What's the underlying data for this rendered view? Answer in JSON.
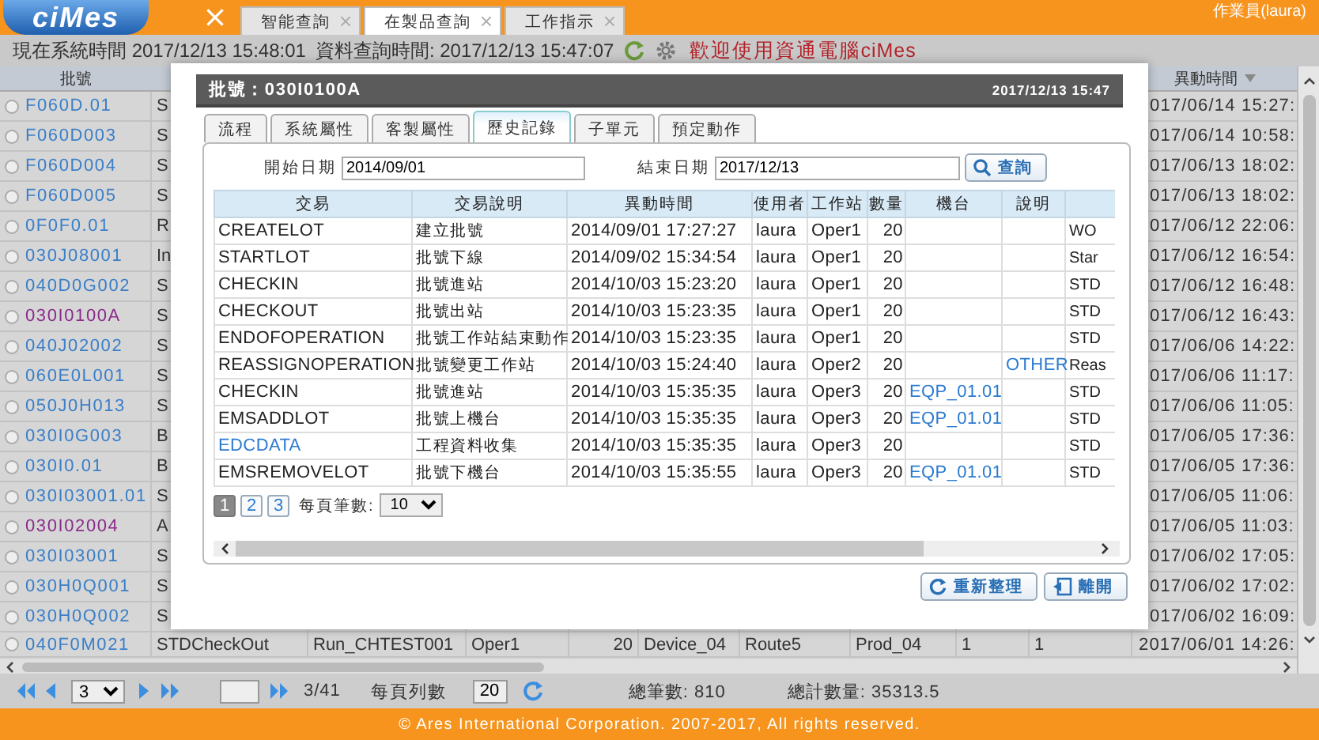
{
  "header": {
    "logo": "ciMes",
    "user": "作業員(laura)",
    "tabs": [
      {
        "label": "智能查詢",
        "selected": false
      },
      {
        "label": "在製品查詢",
        "selected": true
      },
      {
        "label": "工作指示",
        "selected": false
      }
    ]
  },
  "info": {
    "system_time": "現在系統時間 2017/12/13 15:48:01",
    "query_time": "資料查詢時間: 2017/12/13 15:47:07",
    "welcome": "歡迎使用資通電腦ciMes"
  },
  "grid": {
    "lot_header": "批號",
    "time_header": "異動時間",
    "rows": [
      {
        "kind": "covered",
        "selected": false,
        "lot": "F060D.01",
        "color": "#3a7fc8",
        "column_2": "S",
        "time": "017/06/14 15:27:"
      },
      {
        "kind": "covered",
        "selected": false,
        "lot": "F060D003",
        "color": "#3a7fc8",
        "column_2": "S",
        "time": "017/06/14 10:58:"
      },
      {
        "kind": "covered",
        "selected": false,
        "lot": "F060D004",
        "color": "#3a7fc8",
        "column_2": "S",
        "time": "017/06/13 18:02:"
      },
      {
        "kind": "covered",
        "selected": false,
        "lot": "F060D005",
        "color": "#3a7fc8",
        "column_2": "S",
        "time": "017/06/13 18:02:"
      },
      {
        "kind": "covered",
        "selected": false,
        "lot": "0F0F0.01",
        "color": "#3a7fc8",
        "column_2": "R",
        "time": "017/06/12 22:06:"
      },
      {
        "kind": "covered",
        "selected": false,
        "lot": "030J08001",
        "color": "#3a7fc8",
        "column_2": "In",
        "time": "017/06/12 16:54:"
      },
      {
        "kind": "covered",
        "selected": false,
        "lot": "040D0G002",
        "color": "#3a7fc8",
        "column_2": "S",
        "time": "017/06/12 16:48:"
      },
      {
        "kind": "covered",
        "selected": false,
        "lot": "030I0100A",
        "color": "#8b2c8b",
        "column_2": "S",
        "time": "017/06/12 16:43:"
      },
      {
        "kind": "covered",
        "selected": false,
        "lot": "040J02002",
        "color": "#3a7fc8",
        "column_2": "S",
        "time": "017/06/06 14:22:"
      },
      {
        "kind": "covered",
        "selected": false,
        "lot": "060E0L001",
        "color": "#3a7fc8",
        "column_2": "S",
        "time": "017/06/06 11:17:"
      },
      {
        "kind": "covered",
        "selected": false,
        "lot": "050J0H013",
        "color": "#3a7fc8",
        "column_2": "S",
        "time": "017/06/06 11:05:"
      },
      {
        "kind": "covered",
        "selected": false,
        "lot": "030I0G003",
        "color": "#3a7fc8",
        "column_2": "B",
        "time": "017/06/05 17:36:"
      },
      {
        "kind": "covered",
        "selected": false,
        "lot": "030I0.01",
        "color": "#3a7fc8",
        "column_2": "B",
        "time": "017/06/05 17:36:"
      },
      {
        "kind": "covered",
        "selected": false,
        "lot": "030I03001.01",
        "color": "#3a7fc8",
        "column_2": "S",
        "time": "017/06/05 11:06:"
      },
      {
        "kind": "covered",
        "selected": false,
        "lot": "030I02004",
        "color": "#8b2c8b",
        "column_2": "A",
        "time": "017/06/05 11:03:"
      },
      {
        "kind": "covered",
        "selected": false,
        "lot": "030I03001",
        "color": "#3a7fc8",
        "column_2": "S",
        "time": "017/06/02 17:05:"
      },
      {
        "kind": "covered",
        "selected": false,
        "lot": "030H0Q001",
        "color": "#3a7fc8",
        "column_2": "S",
        "time": "017/06/02 17:02:"
      },
      {
        "kind": "covered",
        "selected": false,
        "lot": "030H0Q002",
        "color": "#3a7fc8",
        "column_2": "S",
        "time": "017/06/02 16:09:"
      },
      {
        "kind": "full",
        "selected": false,
        "lot": "040F0M021",
        "color": "#3a7fc8",
        "column_2": "STDCheckOut",
        "cells": [
          "Run_CHTEST001",
          "Oper1",
          "20",
          "Device_04",
          "Route5",
          "Prod_04",
          "1",
          "1"
        ],
        "time": "2017/06/01 14:26:"
      }
    ]
  },
  "pager": {
    "page": "3",
    "page_count": "3/41",
    "rows_per_page_label": "每頁列數",
    "rows_per_page": "20",
    "total_records": "總筆數: 810",
    "total_quantity": "總計數量: 35313.5"
  },
  "footer": "© Ares International Corporation. 2007-2017, All rights reserved.",
  "dialog": {
    "title": "批號：030I0100A",
    "date": "2017/12/13 15:47",
    "tabs": [
      {
        "label": "流程",
        "selected": false
      },
      {
        "label": "系統屬性",
        "selected": false
      },
      {
        "label": "客製屬性",
        "selected": false
      },
      {
        "label": "歷史記錄",
        "selected": true
      },
      {
        "label": "子單元",
        "selected": false
      },
      {
        "label": "預定動作",
        "selected": false
      }
    ],
    "start_label": "開始日期",
    "start": "2014/09/01",
    "end_label": "結束日期",
    "end": "2017/12/13",
    "query_button": "查詢",
    "columns": [
      "交易",
      "交易說明",
      "異動時間",
      "使用者",
      "工作站",
      "數量",
      "機台",
      "說明"
    ],
    "rows": [
      {
        "trans": "CREATELOT",
        "trans_link": false,
        "desc": "建立批號",
        "time": "2014/09/01 17:27:27",
        "user": "laura",
        "station": "Oper1",
        "qty": "20",
        "column_9": "WO"
      },
      {
        "trans": "STARTLOT",
        "trans_link": false,
        "desc": "批號下線",
        "time": "2014/09/02 15:34:54",
        "user": "laura",
        "station": "Oper1",
        "qty": "20",
        "column_9": "Star"
      },
      {
        "trans": "CHECKIN",
        "trans_link": false,
        "desc": "批號進站",
        "time": "2014/10/03 15:23:20",
        "user": "laura",
        "station": "Oper1",
        "qty": "20",
        "column_9": "STD"
      },
      {
        "trans": "CHECKOUT",
        "trans_link": false,
        "desc": "批號出站",
        "time": "2014/10/03 15:23:35",
        "user": "laura",
        "station": "Oper1",
        "qty": "20",
        "column_9": "STD"
      },
      {
        "trans": "ENDOFOPERATION",
        "trans_link": false,
        "desc": "批號工作站結束動作",
        "time": "2014/10/03 15:23:35",
        "user": "laura",
        "station": "Oper1",
        "qty": "20",
        "column_9": "STD"
      },
      {
        "trans": "REASSIGNOPERATION",
        "trans_link": false,
        "desc": "批號變更工作站",
        "time": "2014/10/03 15:24:40",
        "user": "laura",
        "station": "Oper2",
        "qty": "20",
        "note": "OTHER",
        "column_9": "Reas"
      },
      {
        "trans": "CHECKIN",
        "trans_link": false,
        "desc": "批號進站",
        "time": "2014/10/03 15:35:35",
        "user": "laura",
        "station": "Oper3",
        "qty": "20",
        "machine": "EQP_01.01",
        "column_9": "STD"
      },
      {
        "trans": "EMSADDLOT",
        "trans_link": false,
        "desc": "批號上機台",
        "time": "2014/10/03 15:35:35",
        "user": "laura",
        "station": "Oper3",
        "qty": "20",
        "machine": "EQP_01.01",
        "column_9": "STD"
      },
      {
        "trans": "EDCDATA",
        "trans_link": true,
        "desc": "工程資料收集",
        "time": "2014/10/03 15:35:35",
        "user": "laura",
        "station": "Oper3",
        "qty": "20",
        "column_9": "STD"
      },
      {
        "trans": "EMSREMOVELOT",
        "trans_link": false,
        "desc": "批號下機台",
        "time": "2014/10/03 15:35:55",
        "user": "laura",
        "station": "Oper3",
        "qty": "20",
        "machine": "EQP_01.01",
        "column_9": "STD"
      }
    ],
    "pages": [
      {
        "label": "1",
        "selected": true
      },
      {
        "label": "2",
        "selected": false
      },
      {
        "label": "3",
        "selected": false
      }
    ],
    "per_page_label": "每頁筆數:",
    "per_page": "10",
    "buttons": [
      {
        "label": "重新整理",
        "kind": "refresh"
      },
      {
        "label": "離開",
        "kind": "exit"
      }
    ]
  }
}
